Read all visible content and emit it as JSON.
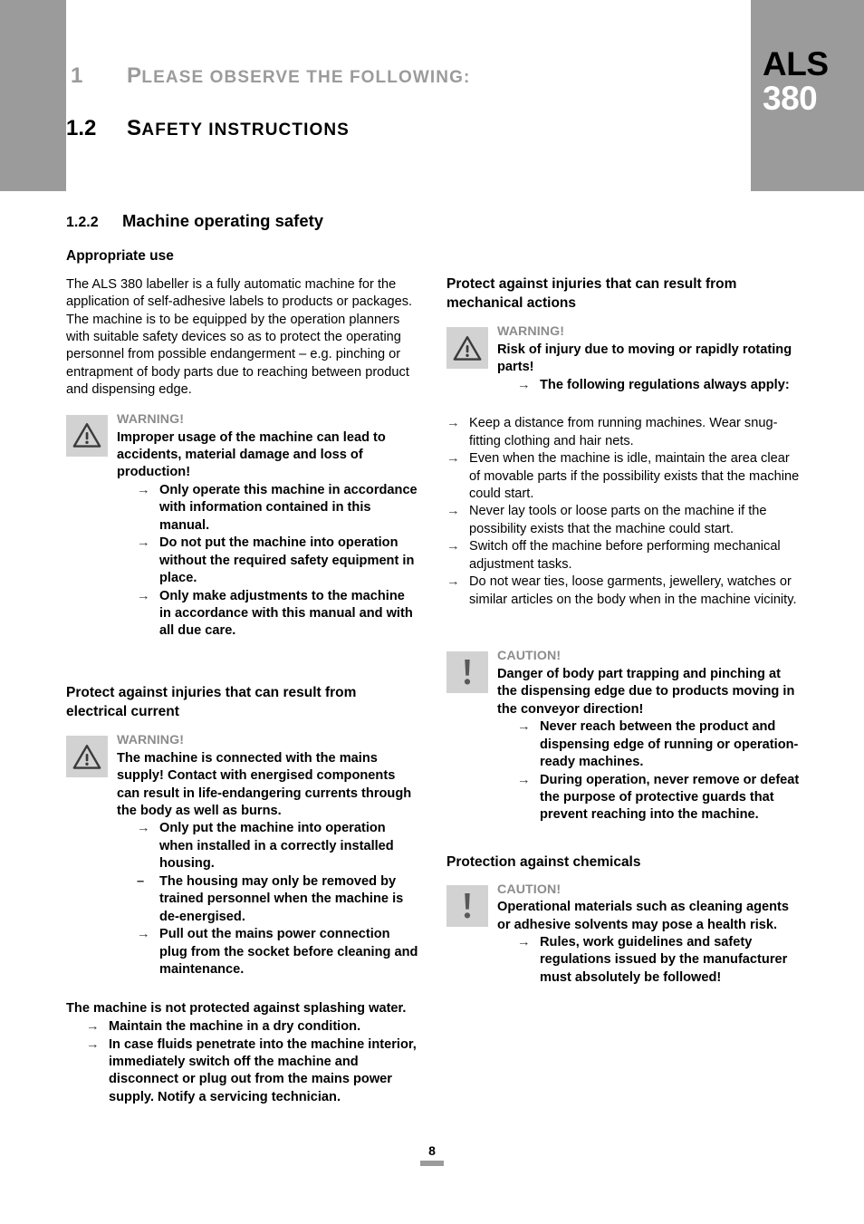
{
  "header": {
    "chapter_number": "1",
    "chapter_title_cap": "P",
    "chapter_title_rest": "lease observe the following:",
    "section_number": "1.2",
    "section_title_cap": "S",
    "section_title_rest": "afety instructions",
    "brand_name": "ALS",
    "brand_model": "380",
    "band_color": "#9b9b9b"
  },
  "main": {
    "subsection_number": "1.2.2",
    "subsection_title": "Machine operating safety",
    "left": {
      "heading_appropriate_use": "Appropriate use",
      "intro_paragraph": "The ALS 380 labeller is a fully automatic machine for the application of self-adhesive labels to products or packages. The machine is to be equipped by the operation planners with suitable safety devices so as to protect the operating personnel from possible endangerment – e.g. pinching or entrapment of body parts due to reaching between product and dispensing edge.",
      "warning_improper_use": {
        "icon": "warning-triangle-icon",
        "label": "WARNING!",
        "body": "Improper usage of the machine can lead to accidents, material damage and loss of production!",
        "items": [
          {
            "marker": "→",
            "text": "Only operate this machine in accordance with information contained in this manual."
          },
          {
            "marker": "→",
            "text": "Do not put the machine into operation without the required safety equipment in place."
          },
          {
            "marker": "→",
            "text": "Only make adjustments to the machine in accordance with this manual and with all due care."
          }
        ]
      },
      "heading_electrical": "Protect against injuries that can result from electrical current",
      "warning_electrical": {
        "icon": "warning-triangle-icon",
        "label": "WARNING!",
        "body": "The machine is connected with the mains supply! Contact with energised components can result in life-endangering currents through the body as well as burns.",
        "items": [
          {
            "marker": "→",
            "text": "Only put the machine into operation when installed in a correctly installed housing."
          },
          {
            "marker": "–",
            "text": "The housing may only be removed by trained personnel when the machine is de-energised."
          },
          {
            "marker": "→",
            "text": "Pull out the mains power connection plug from the socket before cleaning and maintenance."
          }
        ]
      },
      "splash_lead": "The machine is not protected against splashing water.",
      "splash_items": [
        {
          "marker": "→",
          "text": "Maintain the machine in a dry condition."
        },
        {
          "marker": "→",
          "text": "In case fluids penetrate into the machine interior, immediately switch off the machine and disconnect or plug out from the mains power supply. Notify a servicing technician."
        }
      ]
    },
    "right": {
      "heading_mechanical": "Protect against injuries that can result from mechanical actions",
      "warning_mechanical": {
        "icon": "warning-triangle-icon",
        "label": "WARNING!",
        "body": "Risk of injury due to moving or rapidly rotating parts!",
        "items": [
          {
            "marker": "→",
            "text": "The following regulations always apply:"
          }
        ]
      },
      "mechanical_items": [
        {
          "marker": "→",
          "text": "Keep a distance from running machines. Wear snug-fitting clothing and hair nets."
        },
        {
          "marker": "→",
          "text": "Even when the machine is idle, maintain the area clear of movable parts if the possibility exists that the machine could start."
        },
        {
          "marker": "→",
          "text": "Never lay tools or loose parts on the machine if the possibility exists that the machine could start."
        },
        {
          "marker": "→",
          "text": "Switch off the machine before performing mechanical adjustment tasks."
        },
        {
          "marker": "→",
          "text": "Do not wear ties, loose garments, jewellery, watches or similar articles on the body when in the machine vicinity."
        }
      ],
      "caution_pinching": {
        "icon": "exclamation-icon",
        "label": "CAUTION!",
        "body": "Danger of body part trapping and pinching at the dispensing edge due to products moving in the conveyor direction!",
        "items": [
          {
            "marker": "→",
            "text": "Never reach between the product and dispensing edge of running or operation-ready machines."
          },
          {
            "marker": "→",
            "text": "During operation, never remove or defeat the purpose of protective guards that prevent reaching into the machine."
          }
        ]
      },
      "heading_chemicals": "Protection against chemicals",
      "caution_chemicals": {
        "icon": "exclamation-icon",
        "label": "CAUTION!",
        "body": "Operational materials such as cleaning agents or adhesive solvents may pose a health risk.",
        "items": [
          {
            "marker": "→",
            "text": "Rules, work guidelines and safety regulations issued by the manufacturer must absolutely be followed!"
          }
        ]
      }
    }
  },
  "footer": {
    "page_number": "8"
  }
}
